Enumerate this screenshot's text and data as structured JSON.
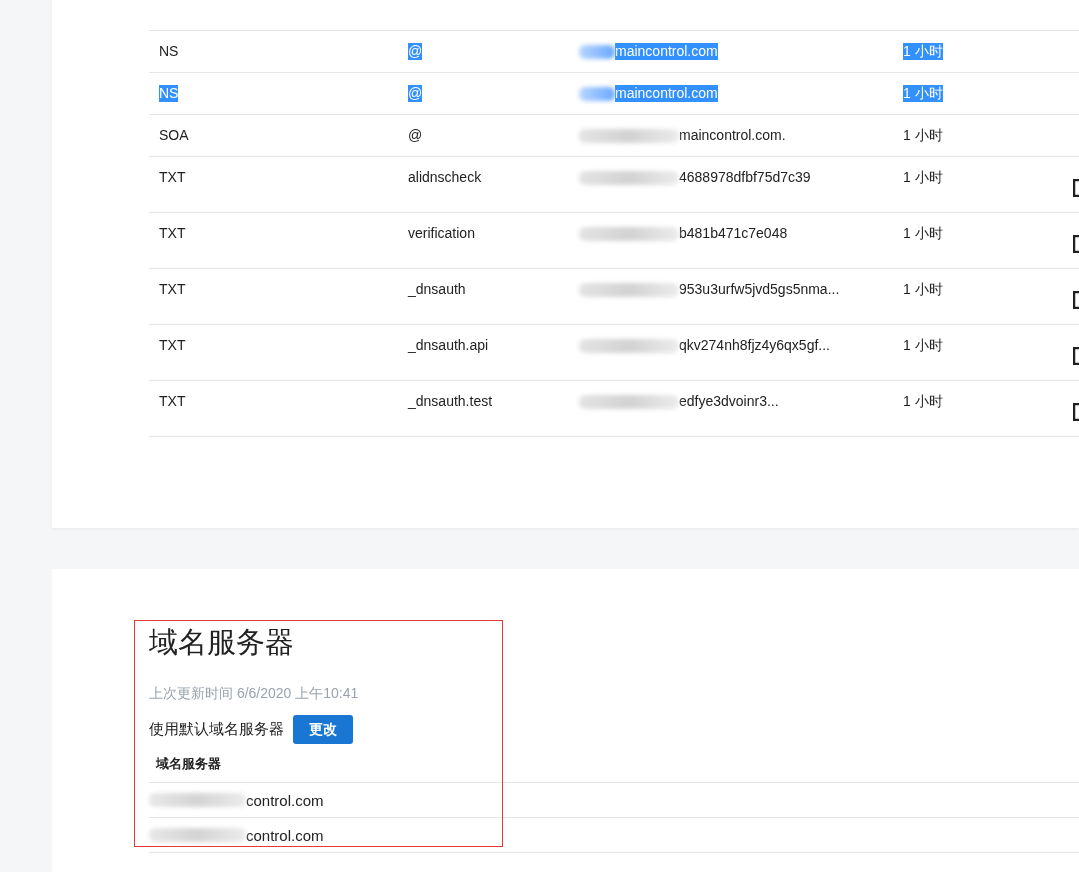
{
  "records": {
    "rows": [
      {
        "type": {
          "text": "NS",
          "highlighted": false
        },
        "name": {
          "text": "@",
          "highlighted": true
        },
        "value": {
          "text": "maincontrol.com",
          "highlighted": true,
          "redacted": true
        },
        "ttl": {
          "text": "1 小时",
          "highlighted": true
        },
        "action_icon": false
      },
      {
        "type": {
          "text": "NS",
          "highlighted": true
        },
        "name": {
          "text": "@",
          "highlighted": true
        },
        "value": {
          "text": "maincontrol.com",
          "highlighted": true,
          "redacted": true
        },
        "ttl": {
          "text": "1 小时",
          "highlighted": true
        },
        "action_icon": false
      },
      {
        "type": {
          "text": "SOA",
          "highlighted": false
        },
        "name": {
          "text": "@",
          "highlighted": false
        },
        "value": {
          "text": "maincontrol.com.",
          "highlighted": false,
          "redacted": true
        },
        "ttl": {
          "text": "1 小时",
          "highlighted": false
        },
        "action_icon": false
      },
      {
        "type": {
          "text": "TXT",
          "highlighted": false
        },
        "name": {
          "text": "alidnscheck",
          "highlighted": false
        },
        "value": {
          "text": "4688978dfbf75d7c39",
          "highlighted": false,
          "redacted": true
        },
        "ttl": {
          "text": "1 小时",
          "highlighted": false
        },
        "action_icon": true
      },
      {
        "type": {
          "text": "TXT",
          "highlighted": false
        },
        "name": {
          "text": "verification",
          "highlighted": false
        },
        "value": {
          "text": "b481b471c7e048",
          "highlighted": false,
          "redacted": true
        },
        "ttl": {
          "text": "1 小时",
          "highlighted": false
        },
        "action_icon": true
      },
      {
        "type": {
          "text": "TXT",
          "highlighted": false
        },
        "name": {
          "text": "_dnsauth",
          "highlighted": false
        },
        "value": {
          "text": "953u3urfw5jvd5gs5nma...",
          "highlighted": false,
          "redacted": true
        },
        "ttl": {
          "text": "1 小时",
          "highlighted": false
        },
        "action_icon": true
      },
      {
        "type": {
          "text": "TXT",
          "highlighted": false
        },
        "name": {
          "text": "_dnsauth.api",
          "highlighted": false
        },
        "value": {
          "text": "qkv274nh8fjz4y6qx5gf...",
          "highlighted": false,
          "redacted": true
        },
        "ttl": {
          "text": "1 小时",
          "highlighted": false
        },
        "action_icon": true
      },
      {
        "type": {
          "text": "TXT",
          "highlighted": false
        },
        "name": {
          "text": "_dnsauth.test",
          "highlighted": false
        },
        "value": {
          "text": "edfye3dvoinr3...",
          "highlighted": false,
          "redacted": true
        },
        "ttl": {
          "text": "1 小时",
          "highlighted": false
        },
        "action_icon": true
      }
    ]
  },
  "nameservers": {
    "title": "域名服务器",
    "updated": "上次更新时间 6/6/2020 上午10:41",
    "mode_label": "使用默认域名服务器",
    "change_button": "更改",
    "column": "域名服务器",
    "servers": [
      {
        "text": "control.com",
        "redacted": true
      },
      {
        "text": "control.com",
        "redacted": true
      }
    ]
  }
}
